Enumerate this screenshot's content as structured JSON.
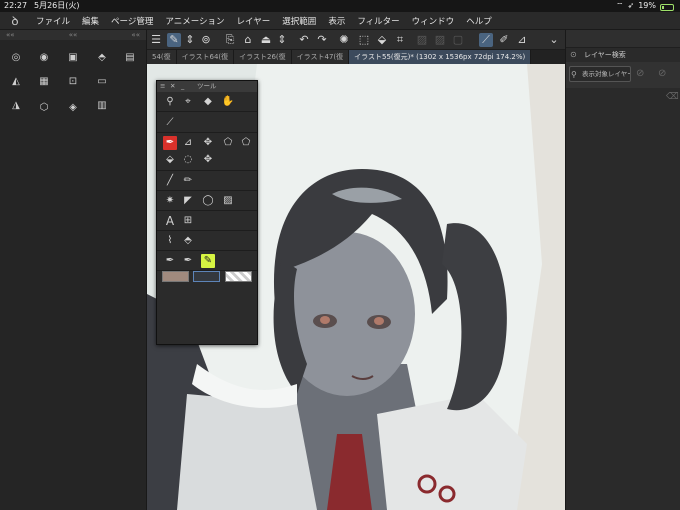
{
  "status_bar": {
    "time": "22:27",
    "date": "5月26日(火)",
    "battery": "19%"
  },
  "menu": {
    "logo_icon": "clip-studio-logo-icon",
    "items": [
      "ファイル",
      "編集",
      "ページ管理",
      "アニメーション",
      "レイヤー",
      "選択範囲",
      "表示",
      "フィルター",
      "ウィンドウ",
      "ヘルプ"
    ]
  },
  "left_panel": {
    "strip_left": "««",
    "strip_mid": "««",
    "strip_right": "««"
  },
  "tabs": [
    {
      "label": "54(復",
      "active": false
    },
    {
      "label": "イラスト64(復",
      "active": false
    },
    {
      "label": "イラスト26(復",
      "active": false
    },
    {
      "label": "イラスト47(復",
      "active": false
    },
    {
      "label": "イラスト55(復元)* (1302 x 1536px 72dpi 174.2%)",
      "active": true
    }
  ],
  "right_panel": {
    "title": "レイヤー検索",
    "search_placeholder": "表示対象レイヤー"
  },
  "tool_palette": {
    "title": "ツール"
  },
  "colors": {
    "accent": "#4a6480",
    "selected_tool": "#d7f542",
    "red_tool": "#d9312b",
    "main_color": "#a08a7e",
    "sub_color": "#5d84b8"
  }
}
